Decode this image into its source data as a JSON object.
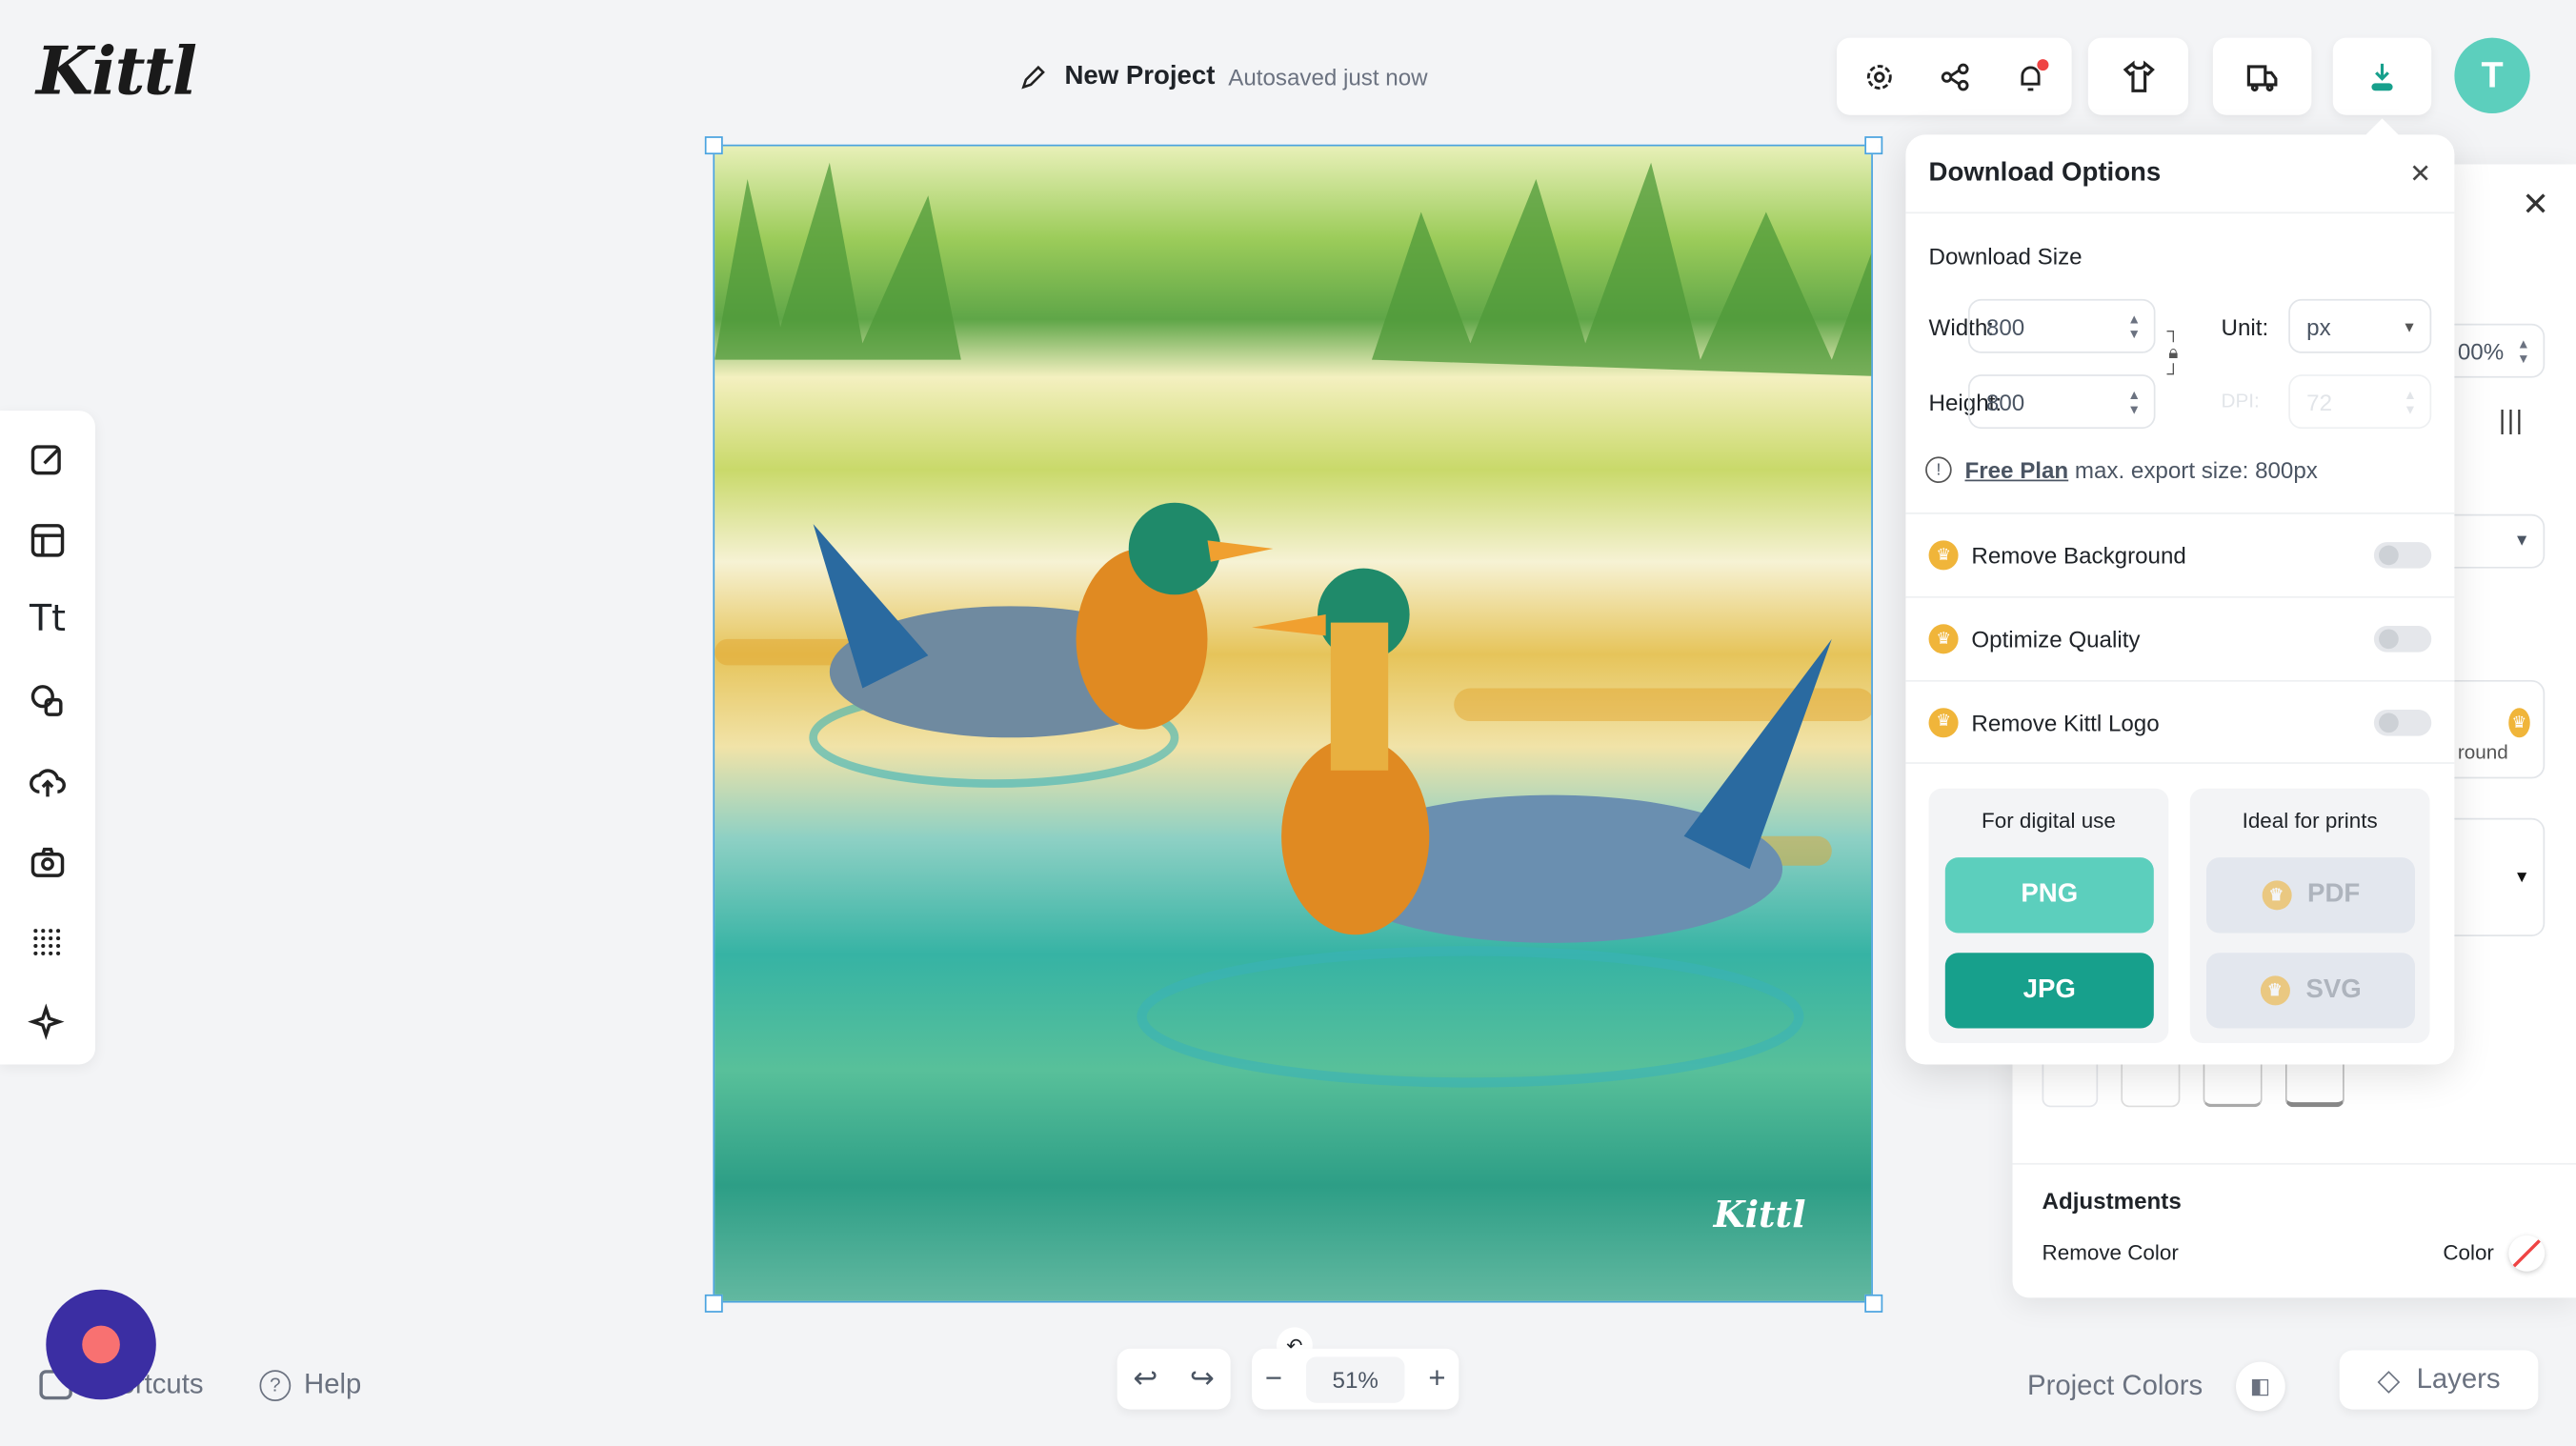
{
  "app": {
    "logo": "Kittl"
  },
  "header": {
    "project_name": "New Project",
    "save_status": "Autosaved just now",
    "avatar_initial": "T",
    "icons": [
      "settings-icon",
      "share-icon",
      "notifications-icon",
      "tshirt-icon",
      "delivery-truck-icon",
      "download-icon"
    ],
    "accent": "#5ccfbd",
    "notification_dot": "#ef4444"
  },
  "left_toolbar": {
    "icons": [
      "edit-icon",
      "templates-icon",
      "text-icon",
      "shapes-icon",
      "upload-icon",
      "camera-icon",
      "pattern-icon",
      "ai-sparkle-icon"
    ]
  },
  "canvas": {
    "watermark": "Kittl"
  },
  "download_options": {
    "title": "Download Options",
    "size_heading": "Download Size",
    "width_label": "Width:",
    "width_value": "800",
    "height_label": "Height:",
    "height_value": "800",
    "unit_label": "Unit:",
    "unit_value": "px",
    "dpi_label": "DPI:",
    "dpi_value": "72",
    "plan_link": "Free Plan",
    "plan_note": "max. export size: 800px",
    "options": [
      {
        "label": "Remove Background",
        "enabled": false
      },
      {
        "label": "Optimize Quality",
        "enabled": false
      },
      {
        "label": "Remove Kittl Logo",
        "enabled": false
      }
    ],
    "digital": {
      "heading": "For digital use",
      "formats": [
        "PNG",
        "JPG"
      ]
    },
    "prints": {
      "heading": "Ideal for prints",
      "formats": [
        "PDF",
        "SVG"
      ]
    },
    "colors": {
      "png": "#5ccfbd",
      "jpg": "#17a08c",
      "premium": "#f0b53a"
    }
  },
  "right_panel": {
    "opacity_value": "00%",
    "partial_label": "round",
    "adjustments_heading": "Adjustments",
    "remove_color_label": "Remove Color",
    "color_label": "Color"
  },
  "footer": {
    "shortcuts": "Shortcuts",
    "help": "Help",
    "zoom": "51%",
    "project_colors": "Project Colors",
    "layers": "Layers"
  }
}
